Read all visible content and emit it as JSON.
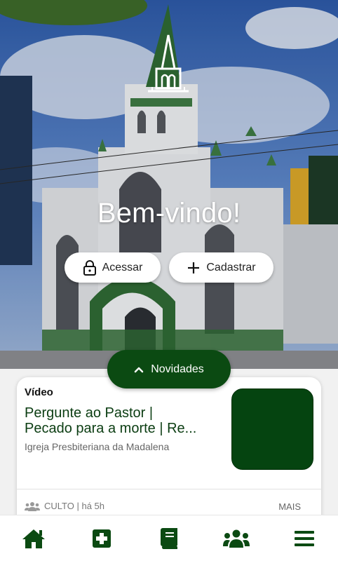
{
  "hero": {
    "welcome": "Bem-vindo!",
    "login_label": "Acessar",
    "register_label": "Cadastrar"
  },
  "news_button": {
    "label": "Novidades"
  },
  "card": {
    "type": "Vídeo",
    "title_line1": "Pergunte ao Pastor |",
    "title_line2": "Pecado para a morte | Re...",
    "source": "Igreja Presbiteriana da Madalena",
    "meta": "CULTO | há 5h",
    "more_label": "MAIS"
  },
  "bottom_nav": {
    "items": [
      "home-icon",
      "plus-square-icon",
      "book-icon",
      "group-icon",
      "menu-icon"
    ]
  },
  "colors": {
    "brand_green": "#0b4a12",
    "accent_dark_green": "#054410"
  }
}
